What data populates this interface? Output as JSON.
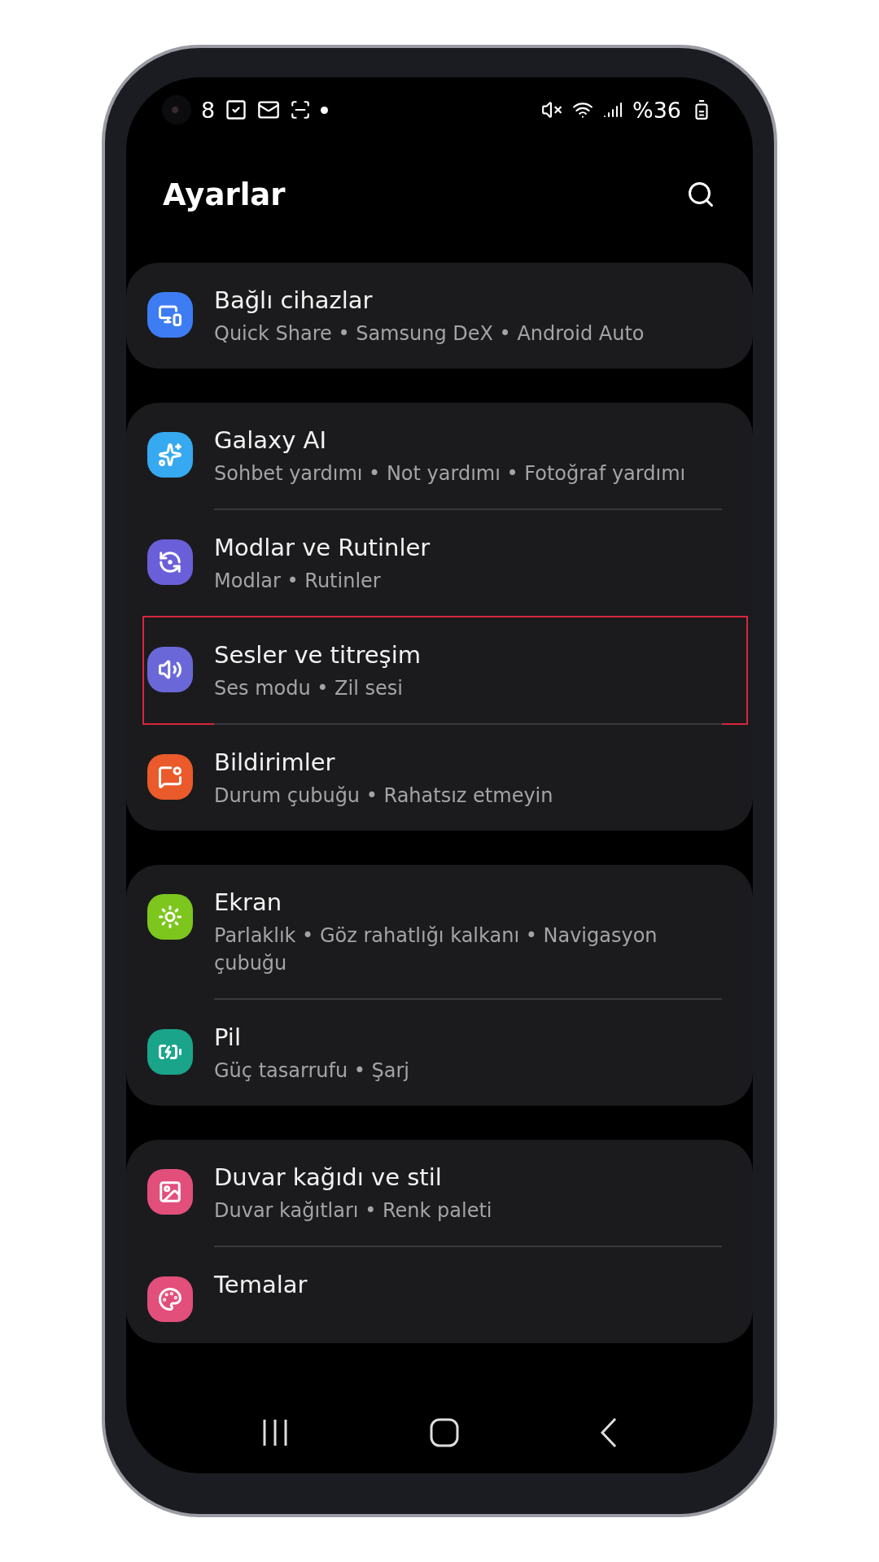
{
  "status_bar": {
    "time": "8",
    "battery": "%36"
  },
  "header": {
    "title": "Ayarlar"
  },
  "groups": [
    {
      "items": [
        {
          "kind": "devices",
          "color": "#3d7cf2",
          "title": "Bağlı cihazlar",
          "subtitle": "Quick Share • Samsung DeX • Android Auto",
          "highlighted": false
        }
      ]
    },
    {
      "items": [
        {
          "kind": "sparkles",
          "color": "#36a9f0",
          "title": "Galaxy AI",
          "subtitle": "Sohbet yardımı • Not yardımı • Fotoğraf yardımı",
          "highlighted": false
        },
        {
          "kind": "routine",
          "color": "#6a5fd8",
          "title": "Modlar ve Rutinler",
          "subtitle": "Modlar • Rutinler",
          "highlighted": false
        },
        {
          "kind": "sound",
          "color": "#6a68d8",
          "title": "Sesler ve titreşim",
          "subtitle": "Ses modu • Zil sesi",
          "highlighted": true
        },
        {
          "kind": "notification",
          "color": "#ea5a2a",
          "title": "Bildirimler",
          "subtitle": "Durum çubuğu • Rahatsız etmeyin",
          "highlighted": false
        }
      ]
    },
    {
      "items": [
        {
          "kind": "sun",
          "color": "#7cc61e",
          "title": "Ekran",
          "subtitle": "Parlaklık • Göz rahatlığı kalkanı • Navigasyon çubuğu",
          "highlighted": false
        },
        {
          "kind": "battery",
          "color": "#1aa58a",
          "title": "Pil",
          "subtitle": "Güç tasarrufu • Şarj",
          "highlighted": false
        }
      ]
    },
    {
      "items": [
        {
          "kind": "image",
          "color": "#e24f7a",
          "title": "Duvar kağıdı ve stil",
          "subtitle": "Duvar kağıtları • Renk paleti",
          "highlighted": false
        },
        {
          "kind": "palette",
          "color": "#e24f7a",
          "title": "Temalar",
          "highlighted": false
        }
      ]
    }
  ]
}
